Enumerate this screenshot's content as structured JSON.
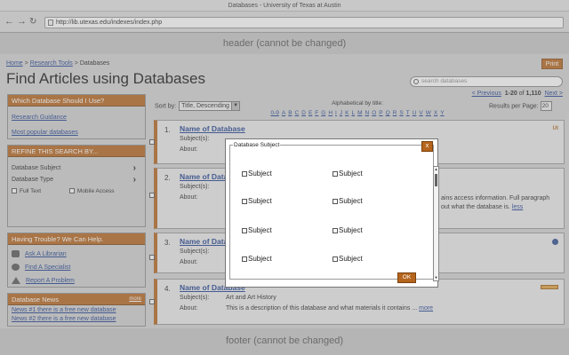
{
  "browser": {
    "title": "Databases - University of Texas at Austin",
    "url": "http://lib.utexas.edu/indexes/index.php"
  },
  "header_text": "header (cannot be changed)",
  "footer_text": "footer (cannot be changed)",
  "breadcrumb": {
    "home": "Home",
    "sep": ">",
    "research_tools": "Research Tools",
    "current": "Databases"
  },
  "print_label": "Print",
  "page_title": "Find Articles using Databases",
  "search": {
    "placeholder": "search databases"
  },
  "pager": {
    "previous": "< Previous",
    "range": "1-20",
    "of": "of",
    "total": "1,110",
    "next": "Next >"
  },
  "sort": {
    "label": "Sort by:",
    "value": "Title, Descending"
  },
  "alpha": {
    "label": "Alphabetical by title:",
    "letters": [
      "0-9",
      "A",
      "B",
      "C",
      "D",
      "E",
      "F",
      "G",
      "H",
      "I",
      "J",
      "K",
      "L",
      "M",
      "N",
      "O",
      "P",
      "Q",
      "R",
      "S",
      "T",
      "U",
      "V",
      "W",
      "X",
      "Y"
    ]
  },
  "results_per_page": {
    "label": "Results per Page:",
    "value": "20"
  },
  "sidebar": {
    "which_db": {
      "title": "Which Database Should I Use?",
      "links": [
        "Research Guidance",
        "Most popular databases"
      ]
    },
    "refine": {
      "title": "REFINE THIS SEARCH BY...",
      "db_subject": "Database Subject",
      "db_type": "Database Type",
      "full_text": "Full Text",
      "mobile_access": "Mobile Access"
    },
    "trouble": {
      "title": "Having Trouble? We Can Help.",
      "links": [
        "Ask A Librarian",
        "Find A Specialist",
        "Report A Problem"
      ]
    },
    "news": {
      "title": "Database News",
      "more": "more",
      "items": [
        "News #1 there is a free new database",
        "News #2 there is a free new database"
      ]
    }
  },
  "results": [
    {
      "num": "1.",
      "name": "Name of Database",
      "subjects_label": "Subject(s):",
      "about_label": "About:",
      "badge": "Ut"
    },
    {
      "num": "2.",
      "name": "Name of Database",
      "subjects_label": "Subject(s):",
      "about_label": "About:",
      "desc_line1": "ains access information. Full paragraph",
      "desc_line2": "out what the database is.",
      "desc_more": "less"
    },
    {
      "num": "3.",
      "name": "Name of Database",
      "subjects_label": "Subject(s):",
      "about_label": "About:"
    },
    {
      "num": "4.",
      "name": "Name of Database",
      "subjects_label": "Subject(s):",
      "subjects_value": "Art and Art History",
      "about_label": "About:",
      "desc": "This is a description of this database and what materials it contains ...",
      "desc_more": "more"
    }
  ],
  "modal": {
    "legend": "Database Subject",
    "close": "x",
    "subjects": [
      "Subject",
      "Subject",
      "Subject",
      "Subject",
      "Subject",
      "Subject",
      "Subject",
      "Subject"
    ],
    "ok": "OK"
  },
  "colors": {
    "accent": "#b5651d",
    "link": "#1a3d8f"
  }
}
